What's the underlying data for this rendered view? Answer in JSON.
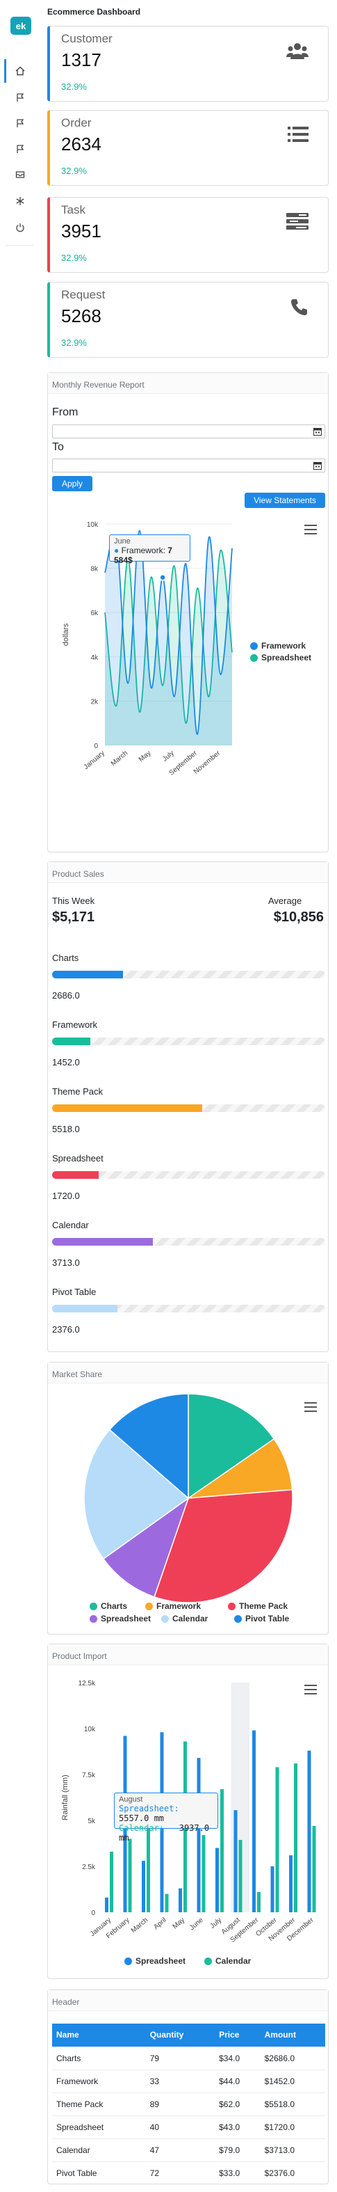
{
  "app": {
    "logo_text": "ek",
    "title": "Ecommerce Dashboard"
  },
  "sidebar": {
    "items": [
      {
        "name": "home-icon",
        "active": true
      },
      {
        "name": "flag-icon"
      },
      {
        "name": "flag-icon"
      },
      {
        "name": "flag-icon"
      },
      {
        "name": "inbox-icon"
      },
      {
        "name": "snowflake-icon"
      },
      {
        "name": "power-icon"
      }
    ]
  },
  "stats": [
    {
      "label": "Customer",
      "value": "1317",
      "pct": "32.9%",
      "icon": "users-icon",
      "color": "#1e88e5"
    },
    {
      "label": "Order",
      "value": "2634",
      "pct": "32.9%",
      "icon": "list-icon",
      "color": "#f9a825"
    },
    {
      "label": "Task",
      "value": "3951",
      "pct": "32.9%",
      "icon": "tasks-icon",
      "color": "#ef3f56"
    },
    {
      "label": "Request",
      "value": "5268",
      "pct": "32.9%",
      "icon": "phone-icon",
      "color": "#1abc9c"
    }
  ],
  "revenue": {
    "title": "Monthly Revenue Report",
    "from_label": "From",
    "to_label": "To",
    "from_value": "",
    "to_value": "",
    "apply_label": "Apply",
    "view_label": "View Statements",
    "tooltip": {
      "title": "June",
      "series": "Framework",
      "value": "7 584$"
    }
  },
  "sales": {
    "title": "Product Sales",
    "week_label": "This Week",
    "week_value": "$5,171",
    "avg_label": "Average",
    "avg_value": "$10,856",
    "products": [
      {
        "name": "Charts",
        "value": "2686.0",
        "fraction": 0.26,
        "color": "#1e88e5"
      },
      {
        "name": "Framework",
        "value": "1452.0",
        "fraction": 0.14,
        "color": "#1abc9c"
      },
      {
        "name": "Theme Pack",
        "value": "5518.0",
        "fraction": 0.55,
        "color": "#f9a825"
      },
      {
        "name": "Spreadsheet",
        "value": "1720.0",
        "fraction": 0.17,
        "color": "#ef3f56"
      },
      {
        "name": "Calendar",
        "value": "3713.0",
        "fraction": 0.37,
        "color": "#9c6ade"
      },
      {
        "name": "Pivot Table",
        "value": "2376.0",
        "fraction": 0.24,
        "color": "#b6dcf9"
      }
    ]
  },
  "market": {
    "title": "Market Share"
  },
  "import": {
    "title": "Product Import",
    "tooltip": {
      "title": "August",
      "s1": "Spreadsheet:",
      "v1": "5557.0 mm",
      "s2": "Calendar:",
      "v2": "3937.0 mm"
    }
  },
  "table": {
    "title": "Header",
    "columns": [
      "Name",
      "Quantity",
      "Price",
      "Amount"
    ],
    "rows": [
      [
        "Charts",
        "79",
        "$34.0",
        "$2686.0"
      ],
      [
        "Framework",
        "33",
        "$44.0",
        "$1452.0"
      ],
      [
        "Theme Pack",
        "89",
        "$62.0",
        "$5518.0"
      ],
      [
        "Spreadsheet",
        "40",
        "$43.0",
        "$1720.0"
      ],
      [
        "Calendar",
        "47",
        "$79.0",
        "$3713.0"
      ],
      [
        "Pivot Table",
        "72",
        "$33.0",
        "$2376.0"
      ]
    ]
  },
  "chart_data": [
    {
      "type": "area",
      "ylabel": "dollars",
      "categories": [
        "January",
        "February",
        "March",
        "April",
        "May",
        "June",
        "July",
        "August",
        "September",
        "October",
        "November",
        "December"
      ],
      "category_labels_shown": [
        "January",
        "March",
        "May",
        "July",
        "September",
        "November"
      ],
      "yticks": [
        "0",
        "2k",
        "4k",
        "6k",
        "8k",
        "10k"
      ],
      "ylim": [
        0,
        10000
      ],
      "series": [
        {
          "name": "Framework",
          "color": "#1e88e5",
          "values": [
            7800,
            9300,
            2800,
            9700,
            2600,
            7584,
            2200,
            8200,
            500,
            9400,
            3200,
            8900
          ]
        },
        {
          "name": "Spreadsheet",
          "color": "#1abc9c",
          "values": [
            6000,
            1800,
            8400,
            1500,
            7600,
            2700,
            8100,
            1000,
            7100,
            2200,
            8800,
            4200
          ]
        }
      ],
      "legend": "right"
    },
    {
      "type": "pie",
      "categories": [
        "Charts",
        "Framework",
        "Theme Pack",
        "Spreadsheet",
        "Calendar",
        "Pivot Table"
      ],
      "values": [
        2686,
        1452,
        5518,
        1720,
        3713,
        2376
      ],
      "colors": [
        "#1abc9c",
        "#f9a825",
        "#ef3f56",
        "#9c6ade",
        "#b6dcf9",
        "#1e88e5"
      ],
      "legend": "bottom"
    },
    {
      "type": "bar",
      "ylabel": "Rainfall (mm)",
      "categories": [
        "January",
        "February",
        "March",
        "April",
        "May",
        "June",
        "July",
        "August",
        "September",
        "October",
        "November",
        "December"
      ],
      "yticks": [
        "0",
        "2.5k",
        "5k",
        "7.5k",
        "10k",
        "12.5k"
      ],
      "ylim": [
        0,
        12500
      ],
      "series": [
        {
          "name": "Spreadsheet",
          "color": "#1e88e5",
          "values": [
            800,
            9600,
            2800,
            9800,
            1300,
            8400,
            3500,
            5557,
            9900,
            2500,
            3100,
            8800
          ]
        },
        {
          "name": "Calendar",
          "color": "#1abc9c",
          "values": [
            3300,
            4000,
            6400,
            1000,
            9300,
            4200,
            6700,
            3937,
            1100,
            7900,
            8100,
            4700
          ]
        }
      ],
      "legend": "bottom"
    }
  ]
}
